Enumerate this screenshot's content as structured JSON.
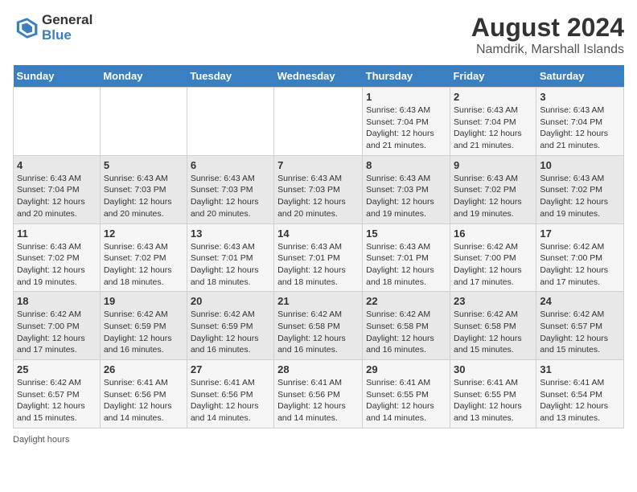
{
  "header": {
    "logo_line1": "General",
    "logo_line2": "Blue",
    "main_title": "August 2024",
    "subtitle": "Namdrik, Marshall Islands"
  },
  "days_of_week": [
    "Sunday",
    "Monday",
    "Tuesday",
    "Wednesday",
    "Thursday",
    "Friday",
    "Saturday"
  ],
  "weeks": [
    [
      {
        "day": "",
        "info": ""
      },
      {
        "day": "",
        "info": ""
      },
      {
        "day": "",
        "info": ""
      },
      {
        "day": "",
        "info": ""
      },
      {
        "day": "1",
        "info": "Sunrise: 6:43 AM\nSunset: 7:04 PM\nDaylight: 12 hours\nand 21 minutes."
      },
      {
        "day": "2",
        "info": "Sunrise: 6:43 AM\nSunset: 7:04 PM\nDaylight: 12 hours\nand 21 minutes."
      },
      {
        "day": "3",
        "info": "Sunrise: 6:43 AM\nSunset: 7:04 PM\nDaylight: 12 hours\nand 21 minutes."
      }
    ],
    [
      {
        "day": "4",
        "info": "Sunrise: 6:43 AM\nSunset: 7:04 PM\nDaylight: 12 hours\nand 20 minutes."
      },
      {
        "day": "5",
        "info": "Sunrise: 6:43 AM\nSunset: 7:03 PM\nDaylight: 12 hours\nand 20 minutes."
      },
      {
        "day": "6",
        "info": "Sunrise: 6:43 AM\nSunset: 7:03 PM\nDaylight: 12 hours\nand 20 minutes."
      },
      {
        "day": "7",
        "info": "Sunrise: 6:43 AM\nSunset: 7:03 PM\nDaylight: 12 hours\nand 20 minutes."
      },
      {
        "day": "8",
        "info": "Sunrise: 6:43 AM\nSunset: 7:03 PM\nDaylight: 12 hours\nand 19 minutes."
      },
      {
        "day": "9",
        "info": "Sunrise: 6:43 AM\nSunset: 7:02 PM\nDaylight: 12 hours\nand 19 minutes."
      },
      {
        "day": "10",
        "info": "Sunrise: 6:43 AM\nSunset: 7:02 PM\nDaylight: 12 hours\nand 19 minutes."
      }
    ],
    [
      {
        "day": "11",
        "info": "Sunrise: 6:43 AM\nSunset: 7:02 PM\nDaylight: 12 hours\nand 19 minutes."
      },
      {
        "day": "12",
        "info": "Sunrise: 6:43 AM\nSunset: 7:02 PM\nDaylight: 12 hours\nand 18 minutes."
      },
      {
        "day": "13",
        "info": "Sunrise: 6:43 AM\nSunset: 7:01 PM\nDaylight: 12 hours\nand 18 minutes."
      },
      {
        "day": "14",
        "info": "Sunrise: 6:43 AM\nSunset: 7:01 PM\nDaylight: 12 hours\nand 18 minutes."
      },
      {
        "day": "15",
        "info": "Sunrise: 6:43 AM\nSunset: 7:01 PM\nDaylight: 12 hours\nand 18 minutes."
      },
      {
        "day": "16",
        "info": "Sunrise: 6:42 AM\nSunset: 7:00 PM\nDaylight: 12 hours\nand 17 minutes."
      },
      {
        "day": "17",
        "info": "Sunrise: 6:42 AM\nSunset: 7:00 PM\nDaylight: 12 hours\nand 17 minutes."
      }
    ],
    [
      {
        "day": "18",
        "info": "Sunrise: 6:42 AM\nSunset: 7:00 PM\nDaylight: 12 hours\nand 17 minutes."
      },
      {
        "day": "19",
        "info": "Sunrise: 6:42 AM\nSunset: 6:59 PM\nDaylight: 12 hours\nand 16 minutes."
      },
      {
        "day": "20",
        "info": "Sunrise: 6:42 AM\nSunset: 6:59 PM\nDaylight: 12 hours\nand 16 minutes."
      },
      {
        "day": "21",
        "info": "Sunrise: 6:42 AM\nSunset: 6:58 PM\nDaylight: 12 hours\nand 16 minutes."
      },
      {
        "day": "22",
        "info": "Sunrise: 6:42 AM\nSunset: 6:58 PM\nDaylight: 12 hours\nand 16 minutes."
      },
      {
        "day": "23",
        "info": "Sunrise: 6:42 AM\nSunset: 6:58 PM\nDaylight: 12 hours\nand 15 minutes."
      },
      {
        "day": "24",
        "info": "Sunrise: 6:42 AM\nSunset: 6:57 PM\nDaylight: 12 hours\nand 15 minutes."
      }
    ],
    [
      {
        "day": "25",
        "info": "Sunrise: 6:42 AM\nSunset: 6:57 PM\nDaylight: 12 hours\nand 15 minutes."
      },
      {
        "day": "26",
        "info": "Sunrise: 6:41 AM\nSunset: 6:56 PM\nDaylight: 12 hours\nand 14 minutes."
      },
      {
        "day": "27",
        "info": "Sunrise: 6:41 AM\nSunset: 6:56 PM\nDaylight: 12 hours\nand 14 minutes."
      },
      {
        "day": "28",
        "info": "Sunrise: 6:41 AM\nSunset: 6:56 PM\nDaylight: 12 hours\nand 14 minutes."
      },
      {
        "day": "29",
        "info": "Sunrise: 6:41 AM\nSunset: 6:55 PM\nDaylight: 12 hours\nand 14 minutes."
      },
      {
        "day": "30",
        "info": "Sunrise: 6:41 AM\nSunset: 6:55 PM\nDaylight: 12 hours\nand 13 minutes."
      },
      {
        "day": "31",
        "info": "Sunrise: 6:41 AM\nSunset: 6:54 PM\nDaylight: 12 hours\nand 13 minutes."
      }
    ]
  ],
  "footer": {
    "text": "Daylight hours"
  }
}
